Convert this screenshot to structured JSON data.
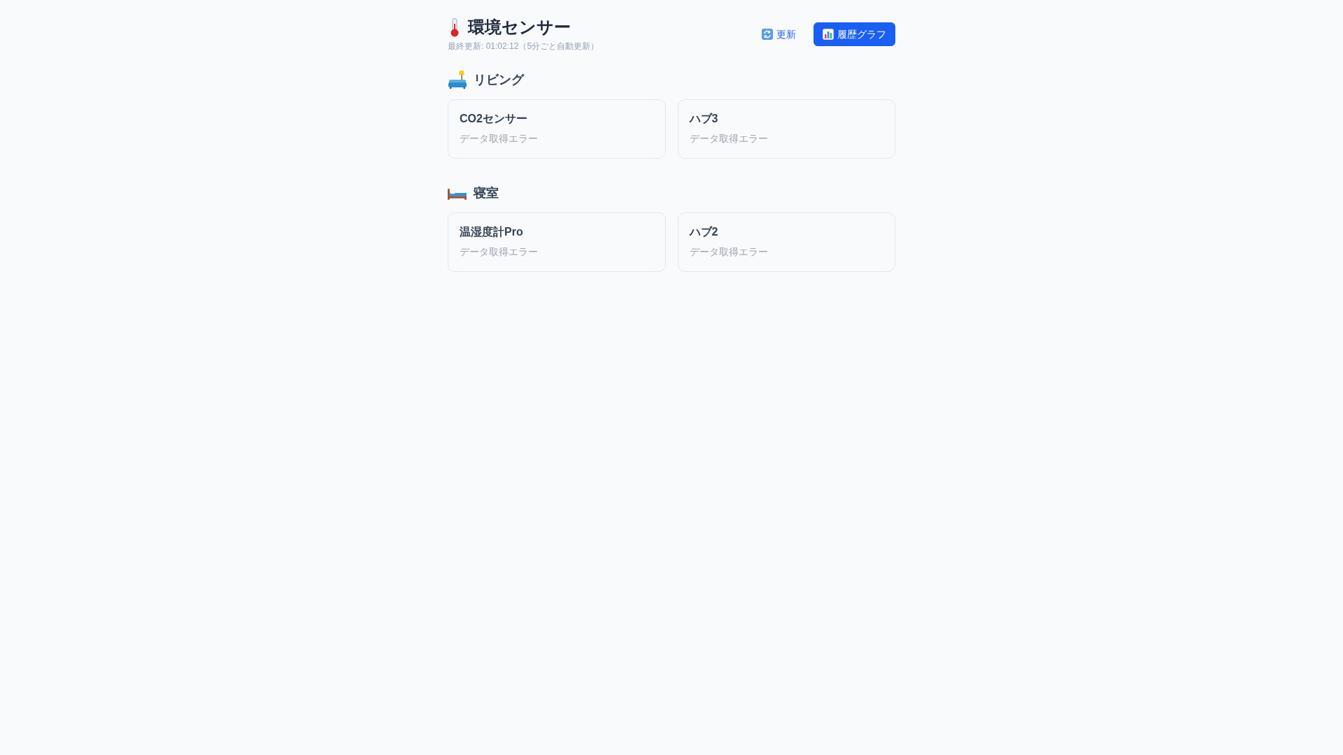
{
  "header": {
    "title": "環境センサー",
    "last_updated": "最終更新: 01:02:12（5分ごと自動更新）",
    "buttons": [
      {
        "kind": "refresh",
        "label": "更新"
      },
      {
        "kind": "history",
        "label": "履歴グラフ"
      }
    ]
  },
  "rooms": [
    {
      "kind": "living",
      "name": "リビング",
      "sensors": [
        {
          "name": "CO2センサー",
          "status": "データ取得エラー"
        },
        {
          "name": "ハブ3",
          "status": "データ取得エラー"
        }
      ]
    },
    {
      "kind": "bedroom",
      "name": "寝室",
      "sensors": [
        {
          "name": "温湿度計Pro",
          "status": "データ取得エラー"
        },
        {
          "name": "ハブ2",
          "status": "データ取得エラー"
        }
      ]
    }
  ]
}
